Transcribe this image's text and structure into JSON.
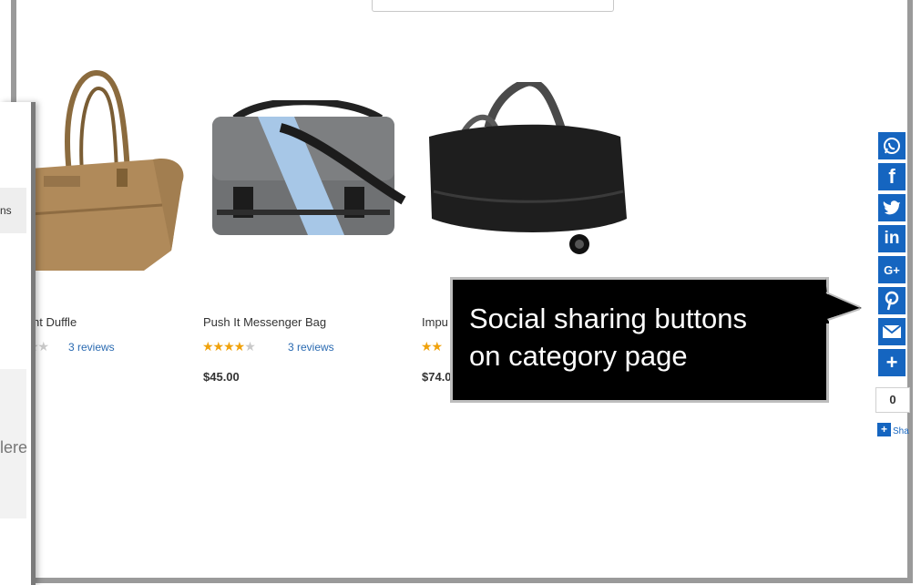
{
  "left_panel": {
    "row1_text": "ns",
    "row2_text": "lere"
  },
  "products": [
    {
      "name": "ht Duffle",
      "rating": 3,
      "max": 5,
      "reviews": "3 reviews",
      "price": ""
    },
    {
      "name": "Push It Messenger Bag",
      "rating": 3.5,
      "max": 5,
      "reviews": "3 reviews",
      "price": "$45.00"
    },
    {
      "name": "Impu",
      "rating": 2,
      "max": 2,
      "reviews": "",
      "price": "$74.0"
    }
  ],
  "share": {
    "buttons": [
      "whatsapp-icon",
      "facebook-icon",
      "twitter-icon",
      "linkedin-icon",
      "google-plus-icon",
      "pinterest-icon",
      "email-icon",
      "plus-icon"
    ],
    "count": "0",
    "more_label": "Sha",
    "color": "#1565c0"
  },
  "callout": {
    "line1": "Social sharing buttons",
    "line2": "on category page"
  }
}
